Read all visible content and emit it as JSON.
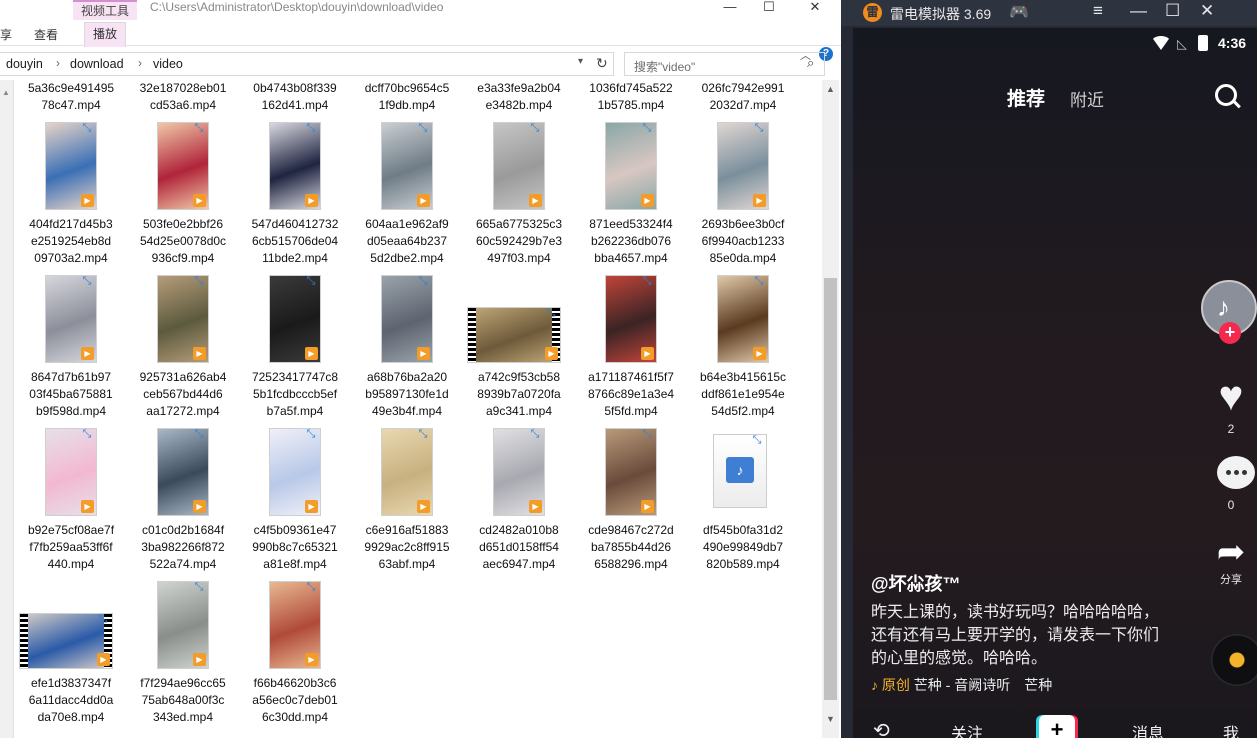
{
  "explorer": {
    "title_path": "C:\\Users\\Administrator\\Desktop\\douyin\\download\\video",
    "context_tab_group": "视频工具",
    "window_controls": [
      "—",
      "☐",
      "✕"
    ],
    "ribbon_tabs": [
      {
        "label": "享"
      },
      {
        "label": "查看"
      },
      {
        "label": "播放"
      }
    ],
    "breadcrumb": [
      "douyin",
      "download",
      "video"
    ],
    "search_placeholder": "搜索\"video\"",
    "top_row_labels": [
      "5a36c9e491495\n78c47.mp4",
      "32e187028eb01\ncd53a6.mp4",
      "0b4743b08f339\n162d41.mp4",
      "dcff70bc9654c5\n1f9db.mp4",
      "e3a33fe9a2b04\ne3482b.mp4",
      "1036fd745a522\n1b5785.mp4",
      "026fc7942e991\n2032d7.mp4"
    ],
    "files": [
      {
        "name": "404fd217d45b3\ne2519254eb8d\n09703a2.mp4",
        "thumb": "tall",
        "c1": "#3a6fb5",
        "c2": "#e7d4c8"
      },
      {
        "name": "503fe0e2bbf26\n54d25e0078d0c\n936cf9.mp4",
        "thumb": "tall",
        "c1": "#b0243a",
        "c2": "#f0c8a8"
      },
      {
        "name": "547d460412732\n6cb515706de04\n11bde2.mp4",
        "thumb": "tall",
        "c1": "#1f2440",
        "c2": "#d8d8e0"
      },
      {
        "name": "604aa1e962af9\nd05eaa64b237\n5d2dbe2.mp4",
        "thumb": "tall",
        "c1": "#6f7c86",
        "c2": "#c9ced2"
      },
      {
        "name": "665a6775325c3\n60c592429b7e3\n497f03.mp4",
        "thumb": "tall",
        "c1": "#9a9a9a",
        "c2": "#c6c6c6"
      },
      {
        "name": "871eed53324f4\nb262236db076\nbba4657.mp4",
        "thumb": "tall",
        "c1": "#d8c7c2",
        "c2": "#8aa7a7"
      },
      {
        "name": "2693b6ee3b0cf\n6f9940acb1233\n85e0da.mp4",
        "thumb": "tall",
        "c1": "#7a8f9c",
        "c2": "#e0d6d2"
      },
      {
        "name": "8647d7b61b97\n03f45ba675881\nb9f598d.mp4",
        "thumb": "tall",
        "c1": "#8c8f9a",
        "c2": "#d6d6dc"
      },
      {
        "name": "925731a626ab4\nceb567bd44d6\naa17272.mp4",
        "thumb": "tall",
        "c1": "#5c5a3e",
        "c2": "#b59c7a"
      },
      {
        "name": "72523417747c8\n5b1fcdbcccb5ef\nb7a5f.mp4",
        "thumb": "tall",
        "c1": "#1a1a1a",
        "c2": "#3a3a3a"
      },
      {
        "name": "a68b76ba2a20\nb95897130fe1d\n49e3b4f.mp4",
        "thumb": "tall",
        "c1": "#5d6470",
        "c2": "#9aa2aa"
      },
      {
        "name": "a742c9f53cb58\n8939b7a0720fa\na9c341.mp4",
        "thumb": "wide",
        "c1": "#6e5a3a",
        "c2": "#c2a97a"
      },
      {
        "name": "a171187461f5f7\n8766c89e1a3e4\n5f5fd.mp4",
        "thumb": "tall",
        "c1": "#3a2424",
        "c2": "#c0443a"
      },
      {
        "name": "b64e3b415615c\nddf861e1e954e\n54d5f2.mp4",
        "thumb": "tall",
        "c1": "#5a3a20",
        "c2": "#e0c8a8"
      },
      {
        "name": "b92e75cf08ae7f\nf7fb259aa53ff6f\n440.mp4",
        "thumb": "tall",
        "c1": "#f2b8d2",
        "c2": "#e7e0e8"
      },
      {
        "name": "c01c0d2b1684f\n3ba982266f872\n522a74.mp4",
        "thumb": "tall",
        "c1": "#3a4a5a",
        "c2": "#a8b8c8"
      },
      {
        "name": "c4f5b09361e47\n990b8c7c65321\na81e8f.mp4",
        "thumb": "tall",
        "c1": "#b8c8e8",
        "c2": "#f0f0f8"
      },
      {
        "name": "c6e916af51883\n9929ac2c8ff915\n63abf.mp4",
        "thumb": "tall",
        "c1": "#c8b080",
        "c2": "#e8d8b0"
      },
      {
        "name": "cd2482a010b8\nd651d0158ff54\naec6947.mp4",
        "thumb": "tall",
        "c1": "#a8a8b0",
        "c2": "#e0e0e4"
      },
      {
        "name": "cde98467c272d\nba7855b44d26\n6588296.mp4",
        "thumb": "tall",
        "c1": "#6a4a3a",
        "c2": "#b89a7a"
      },
      {
        "name": "df545b0fa31d2\n490e99849db7\n820b589.mp4",
        "thumb": "doc",
        "c1": "#3e7fd3",
        "c2": "#ffffff"
      },
      {
        "name": "efe1d3837347f\n6a11dacc4dd0a\nda70e8.mp4",
        "thumb": "wide",
        "c1": "#2a5aa8",
        "c2": "#d8d0c8"
      },
      {
        "name": "f7f294ae96cc65\n75ab648a00f3c\n343ed.mp4",
        "thumb": "tall",
        "c1": "#8a8e8a",
        "c2": "#d0d4d0"
      },
      {
        "name": "f66b46620b3c6\na56ec0c7deb01\n6c30dd.mp4",
        "thumb": "tall",
        "c1": "#b04a3a",
        "c2": "#e8b890"
      }
    ]
  },
  "emulator": {
    "title": "雷电模拟器 3.69",
    "status": {
      "time": "4:36"
    },
    "tabs": {
      "recommend": "推荐",
      "nearby": "附近"
    },
    "side": {
      "likes": "2",
      "comments": "0",
      "share_label": "分享"
    },
    "author": "@坏尛孩™",
    "caption": "昨天上课的，读书好玩吗？哈哈哈哈哈，还有还有马上要开学的，请发表一下你们的心里的感觉。哈哈哈。",
    "music": {
      "note": "♪",
      "original": "原创",
      "text": "芒种 - 音阙诗听　芒种"
    },
    "bottom_nav": {
      "follow": "关注",
      "plus": "+",
      "messages": "消息",
      "me": "我"
    }
  }
}
